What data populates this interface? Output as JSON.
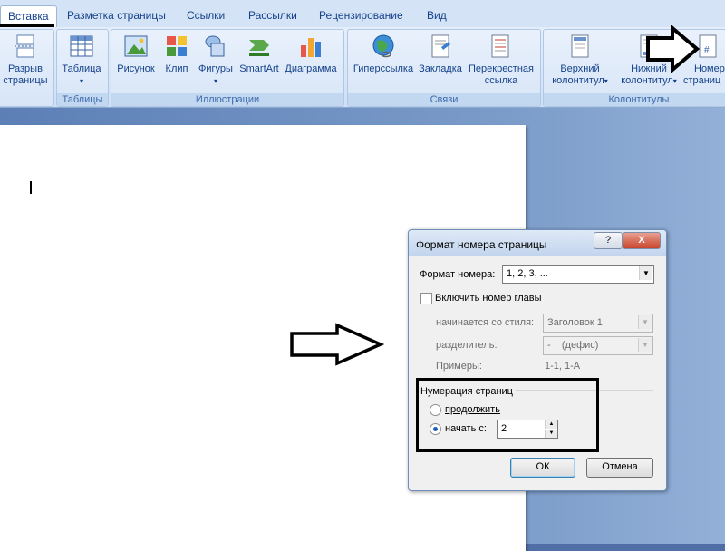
{
  "tabs": [
    {
      "label": "Вставка",
      "active": true
    },
    {
      "label": "Разметка страницы"
    },
    {
      "label": "Ссылки"
    },
    {
      "label": "Рассылки"
    },
    {
      "label": "Рецензирование"
    },
    {
      "label": "Вид"
    }
  ],
  "ribbon": {
    "groups": {
      "pages": {
        "btn1_line1": "Разрыв",
        "btn1_line2": "страницы"
      },
      "tables": {
        "label": "Таблицы",
        "btn": "Таблица"
      },
      "illustrations": {
        "label": "Иллюстрации",
        "picture": "Рисунок",
        "clip": "Клип",
        "shapes": "Фигуры",
        "smartart": "SmartArt",
        "chart": "Диаграмма"
      },
      "links": {
        "label": "Связи",
        "hyperlink": "Гиперссылка",
        "bookmark": "Закладка",
        "crossref_line1": "Перекрестная",
        "crossref_line2": "ссылка"
      },
      "headers": {
        "label": "Колонтитулы",
        "header_line1": "Верхний",
        "header_line2": "колонтитул",
        "footer_line1": "Нижний",
        "footer_line2": "колонтитул",
        "pagenum_line1": "Номер",
        "pagenum_line2": "страниц"
      }
    }
  },
  "dialog": {
    "title": "Формат номера страницы",
    "help_btn": "?",
    "close_btn": "X",
    "number_format_label": "Формат номера:",
    "number_format_value": "1, 2, 3, ...",
    "include_chapter_label": "Включить номер главы",
    "starts_with_style_label": "начинается со стиля:",
    "starts_with_style_value": "Заголовок 1",
    "separator_label": "разделитель:",
    "separator_value": "-    (дефис)",
    "examples_label": "Примеры:",
    "examples_value": "1-1, 1-A",
    "page_numbering_label": "Нумерация страниц",
    "continue_label": "продолжить",
    "start_at_label": "начать с:",
    "start_at_value": "2",
    "ok_label": "ОК",
    "cancel_label": "Отмена"
  }
}
